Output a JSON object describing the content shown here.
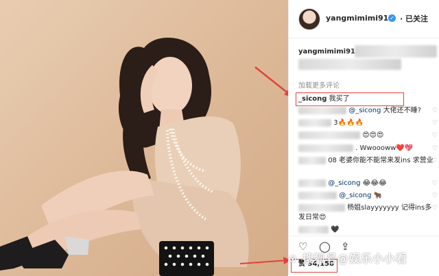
{
  "header": {
    "username": "yangmimimi912",
    "follow_label": "· 已关注",
    "verified_icon": "✓"
  },
  "caption": {
    "username": "yangmimimi912"
  },
  "load_more": "加载更多评论",
  "comments": {
    "c1": {
      "user": "_sicong",
      "text": " 我买了"
    },
    "c2": {
      "mention": "@_sicong",
      "text": " 大佬还不睡?"
    },
    "c3": {
      "prefix": "3",
      "text": "🔥🔥🔥"
    },
    "c4": {
      "text": "😍😍😍"
    },
    "c5": {
      "text": ". Wwoooww❤️💖"
    },
    "c6": {
      "prefix": "08",
      "text": " 老婆你能不能常来发ins 求营业"
    },
    "c7": {
      "mention": "@_sicong",
      "text": " 😂😂😂"
    },
    "c8": {
      "mention": "@_sicong",
      "text": " 🐂"
    },
    "c9": {
      "text": " 杨姐slayyyyyyy 记得ins多发日常😍"
    },
    "c10": {
      "text": "🖤"
    }
  },
  "actions": {
    "like_icon": "♡",
    "comment_icon": "◯",
    "share_icon": "⇪",
    "likes_text": "赞 34,158"
  },
  "watermark": "⊙ 搜狐号@娱乐小小看",
  "colors": {
    "highlight": "#e2413a",
    "link": "#003569",
    "verified": "#3897f0"
  }
}
